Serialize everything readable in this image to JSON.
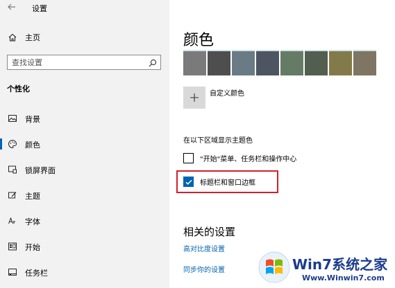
{
  "window": {
    "title": "设置"
  },
  "sidebar": {
    "home_label": "主页",
    "search": {
      "placeholder": "查找设置"
    },
    "section_title": "个性化",
    "items": [
      {
        "label": "背景",
        "icon": "image-icon"
      },
      {
        "label": "颜色",
        "icon": "palette-icon",
        "selected": true
      },
      {
        "label": "锁屏界面",
        "icon": "lock-screen-icon"
      },
      {
        "label": "主题",
        "icon": "theme-icon"
      },
      {
        "label": "字体",
        "icon": "font-icon"
      },
      {
        "label": "开始",
        "icon": "start-icon"
      },
      {
        "label": "任务栏",
        "icon": "taskbar-icon"
      }
    ]
  },
  "main": {
    "title": "颜色",
    "swatches": [
      "#7a7a7a",
      "#4e4e4e",
      "#6b7b85",
      "#4c5561",
      "#667b66",
      "#515e50",
      "#837a4a",
      "#7e7562"
    ],
    "custom_color_label": "自定义颜色",
    "region_label": "在以下区域显示主题色",
    "checkboxes": [
      {
        "label": "\"开始\"菜单、任务栏和操作中心",
        "checked": false
      },
      {
        "label": "标题栏和窗口边框",
        "checked": true
      }
    ],
    "related_title": "相关的设置",
    "links": [
      "高对比度设置",
      "同步你的设置"
    ]
  },
  "watermark": {
    "title": "Win7系统之家",
    "url": "Www.Winwin7.com"
  },
  "colors": {
    "accent": "#0063b1",
    "highlight_border": "#d21f2b",
    "sidebar_bg": "#f2f2f2"
  }
}
